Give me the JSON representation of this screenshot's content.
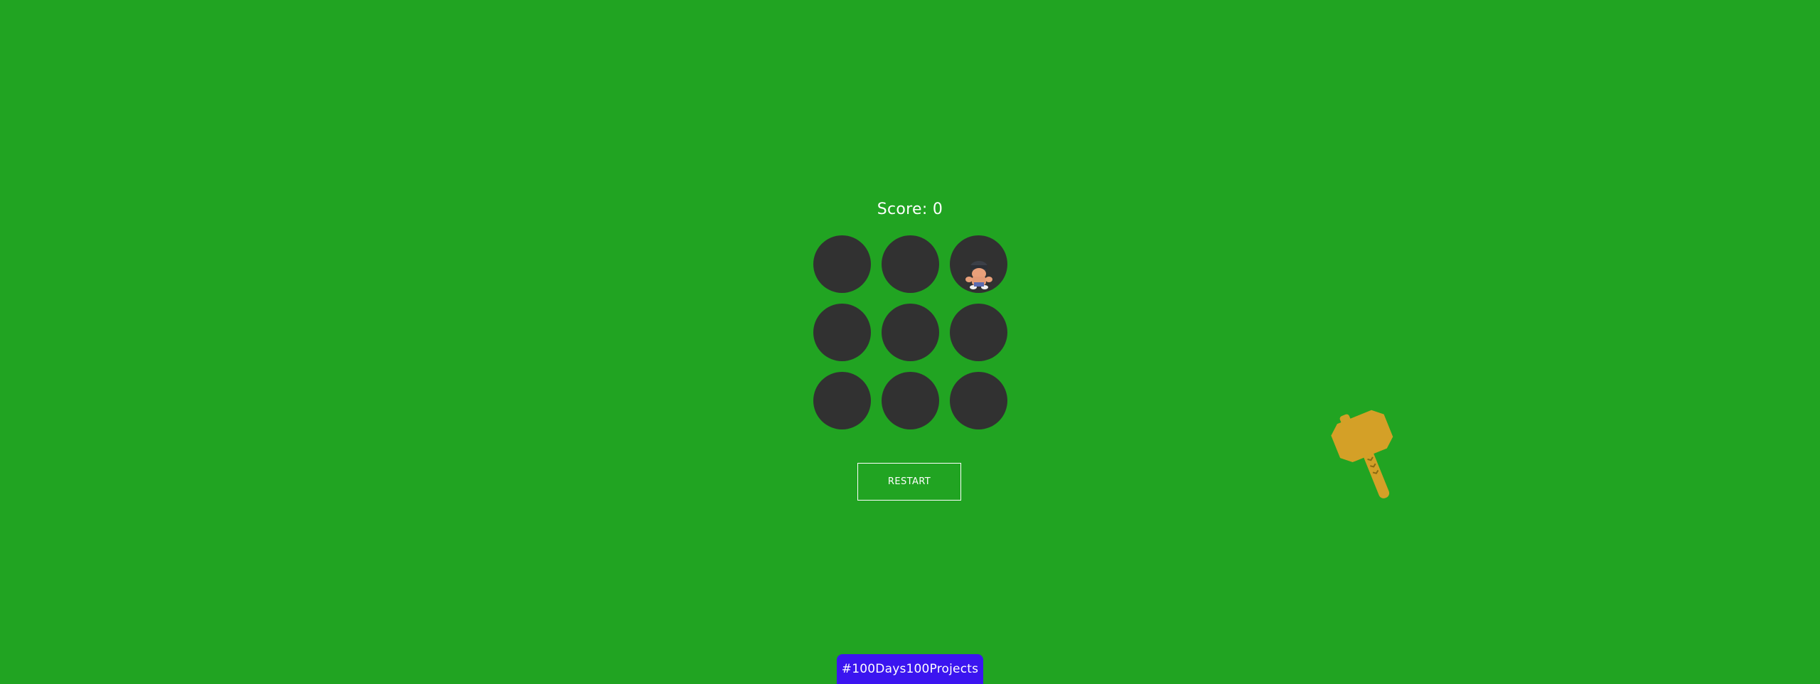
{
  "score": {
    "label": "Score:",
    "value": "0"
  },
  "board": {
    "holes": [
      {
        "has_mole": false
      },
      {
        "has_mole": false
      },
      {
        "has_mole": true
      },
      {
        "has_mole": false
      },
      {
        "has_mole": false
      },
      {
        "has_mole": false
      },
      {
        "has_mole": false
      },
      {
        "has_mole": false
      },
      {
        "has_mole": false
      }
    ]
  },
  "controls": {
    "restart_label": "RESTART"
  },
  "footer": {
    "badge_label": "#100Days100Projects"
  },
  "cursor": {
    "icon": "hammer-icon"
  },
  "colors": {
    "background": "#21a422",
    "hole": "#313131",
    "badge": "#3b15f0",
    "hammer": "#d4a027"
  }
}
